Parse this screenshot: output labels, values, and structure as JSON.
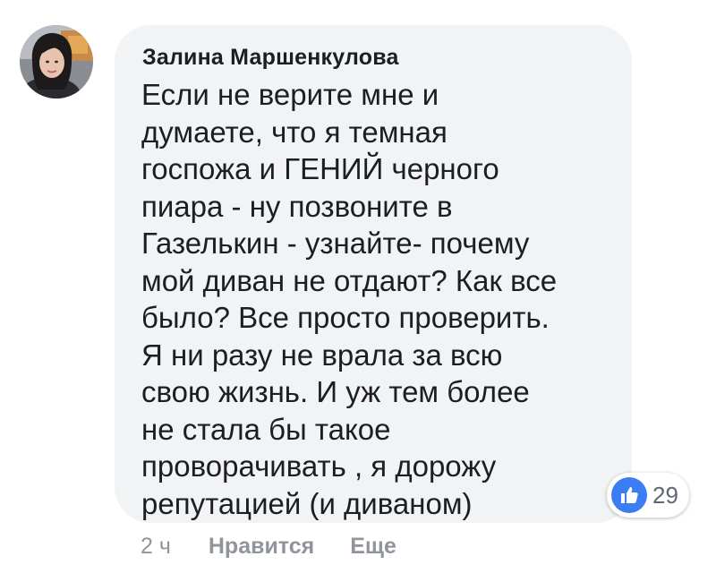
{
  "comment": {
    "author": "Залина Маршенкулова",
    "text": "Если не верите мне и\nдумаете, что я темная\nгоспожа и ГЕНИЙ черного\nпиара - ну позвоните в\nГазелькин - узнайте- почему\nмой диван не отдают? Как все\nбыло? Все просто проверить.\nЯ ни разу не врала за всю\nсвою жизнь. И уж тем более\nне стала бы такое\nпроворачивать , я дорожу\nрепутацией (и диваном)",
    "reactions": {
      "icon": "like-icon",
      "count": "29",
      "color": "#3b7df3"
    }
  },
  "actions": {
    "time": "2 ч",
    "like_label": "Нравится",
    "more_label": "Еще"
  },
  "colors": {
    "bubble": "#f2f3f5",
    "text": "#1c1e21",
    "secondary": "#90949c"
  }
}
